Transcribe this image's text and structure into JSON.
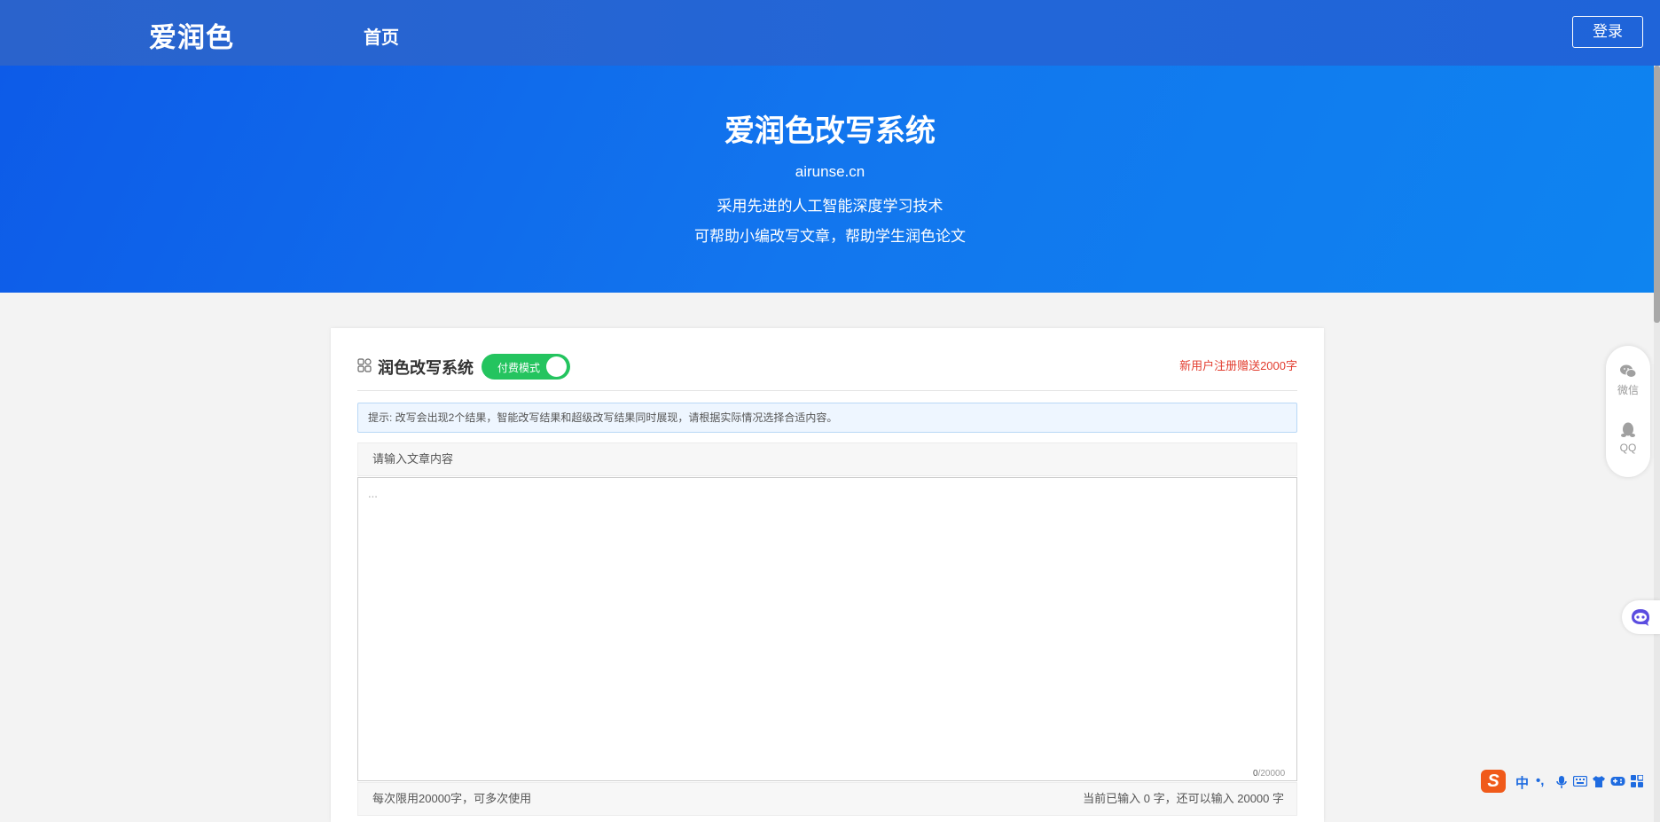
{
  "nav": {
    "logo": "爱润色",
    "home": "首页",
    "login": "登录"
  },
  "hero": {
    "title": "爱润色改写系统",
    "domain": "airunse.cn",
    "line1": "采用先进的人工智能深度学习技术",
    "line2": "可帮助小编改写文章，帮助学生润色论文"
  },
  "card": {
    "title": "润色改写系统",
    "toggle_label": "付费模式",
    "promo": "新用户注册赠送2000字",
    "tip": "提示: 改写会出现2个结果，智能改写结果和超级改写结果同时展现，请根据实际情况选择合适内容。",
    "editor_header": "请输入文章内容",
    "editor_placeholder": "...",
    "editor_value": "",
    "count_current": "0",
    "count_max": "/20000",
    "footer_left": "每次限用20000字，可多次使用",
    "footer_right": "当前已输入 0 字，还可以输入 20000 字"
  },
  "float": {
    "wechat": "微信",
    "qq": "QQ"
  },
  "ime": {
    "logo": "S",
    "lang": "中",
    "punct": "•,",
    "icons": [
      "mic-icon",
      "keyboard-icon",
      "shirt-icon",
      "gamepad-icon",
      "grid-icon"
    ]
  },
  "colors": {
    "nav_bg": "#2266d8",
    "hero_bg": "#1276ee",
    "toggle_on": "#24c45f",
    "promo": "#e23c2e",
    "tip_bg": "#eef6ff"
  }
}
